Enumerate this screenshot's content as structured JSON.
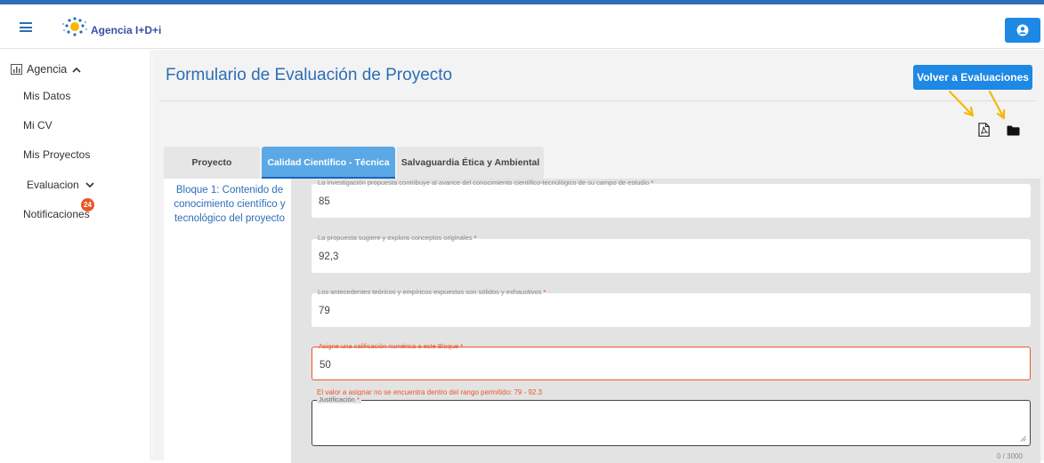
{
  "app": {
    "brand": "Agencia I+D+i"
  },
  "sidebar": {
    "section_label": "Agencia",
    "items": [
      {
        "label": "Mis Datos"
      },
      {
        "label": "Mi CV"
      },
      {
        "label": "Mis Proyectos"
      },
      {
        "label": "Evaluacion"
      },
      {
        "label": "Notificaciones"
      }
    ],
    "notifications_badge": "24"
  },
  "header": {
    "title": "Formulario de Evaluación de Proyecto",
    "back_button": "Volver a Evaluaciones"
  },
  "tabs": [
    {
      "label": "Proyecto",
      "active": false
    },
    {
      "label": "Calidad Científico - Técnica",
      "active": true
    },
    {
      "label": "Salvaguardia Ética y Ambiental",
      "active": false
    }
  ],
  "block": {
    "title": "Bloque 1: Contenido de conocimiento científico y tecnológico del proyecto",
    "fields": [
      {
        "label": "La investigación propuesta contribuye al avance del conocimiento científico-tecnológico de su campo de estudio",
        "required": "*",
        "value": "85"
      },
      {
        "label": "La propuesta sugiere y explora conceptos originales",
        "required": "*",
        "value": "92,3"
      },
      {
        "label": "Los antecedentes teóricos y empíricos expuestos son sólidos y exhaustivos",
        "required": "*",
        "value": "79"
      },
      {
        "label": "Asigne una calificación numérica a este Bloque",
        "required": "*",
        "value": "50"
      }
    ],
    "error_message": "El valor a asignar no se encuentra dentro del rango permitido: 79 - 92.3",
    "justification_label": "Justificación",
    "justification_required": "*",
    "justification_value": "",
    "char_counter": "0 / 3000"
  },
  "colors": {
    "primary": "#1e88e5",
    "title_blue": "#2d6db5",
    "error": "#e8572b",
    "annotation_arrow": "#f5b800"
  }
}
